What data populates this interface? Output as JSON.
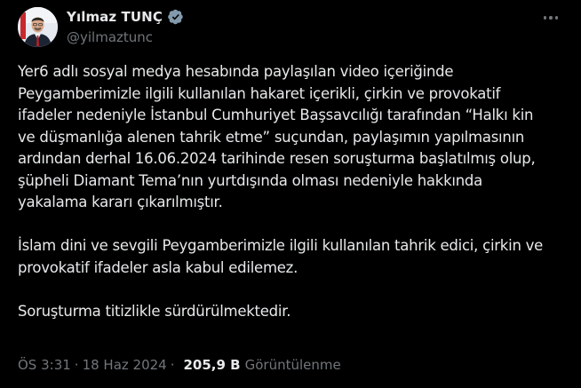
{
  "author": {
    "display_name": "Yılmaz TUNÇ",
    "handle": "@yilmaztunc",
    "verified_badge": "gray-verified-badge-icon"
  },
  "tweet": {
    "paragraphs": [
      [
        "Yer6 adlı sosyal medya hesabında paylaşılan video içeriğinde",
        "Peygamberimizle ilgili kullanılan hakaret içerikli, çirkin ve provokatif",
        "ifadeler nedeniyle İstanbul Cumhuriyet Başsavcılığı tarafından “Halkı kin",
        "ve düşmanlığa alenen tahrik etme” suçundan, paylaşımın yapılmasının",
        "ardından derhal 16.06.2024 tarihinde resen soruşturma başlatılmış olup,",
        "şüpheli Diamant Tema’nın yurtdışında olması nedeniyle hakkında",
        "yakalama kararı çıkarılmıştır."
      ],
      [
        "İslam dini ve sevgili Peygamberimizle ilgili kullanılan tahrik edici, çirkin ve",
        "provokatif ifadeler asla kabul edilemez."
      ],
      [
        "Soruşturma titizlikle sürdürülmektedir."
      ]
    ]
  },
  "meta": {
    "time": "ÖS 3:31",
    "separator": "·",
    "date": "18 Haz 2024",
    "views_count": "205,9 B",
    "views_label": "Görüntülenme"
  },
  "colors": {
    "background": "#000000",
    "text_primary": "#e7e9ea",
    "text_secondary": "#71767b",
    "badge": "#829aab"
  }
}
